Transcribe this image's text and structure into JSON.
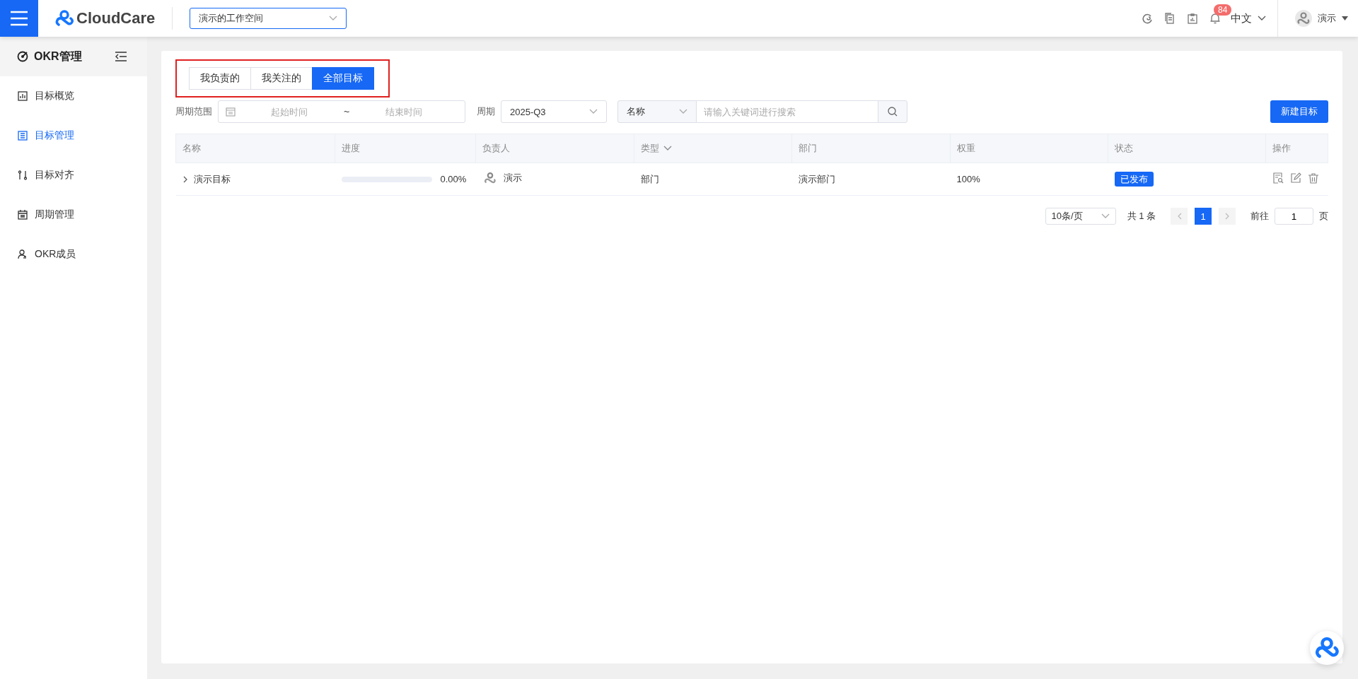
{
  "topbar": {
    "brand": "CloudCare",
    "workspace": "演示的工作空间",
    "notification_count": "84",
    "language": "中文",
    "user": "演示"
  },
  "sidebar": {
    "title": "OKR管理",
    "items": [
      {
        "label": "目标概览",
        "kind": "chart",
        "selected": false
      },
      {
        "label": "目标管理",
        "kind": "list",
        "selected": true
      },
      {
        "label": "目标对齐",
        "kind": "align",
        "selected": false
      },
      {
        "label": "周期管理",
        "kind": "calendar",
        "selected": false
      },
      {
        "label": "OKR成员",
        "kind": "member",
        "selected": false
      }
    ]
  },
  "tabs": [
    {
      "label": "我负责的",
      "selected": false
    },
    {
      "label": "我关注的",
      "selected": false
    },
    {
      "label": "全部目标",
      "selected": true
    }
  ],
  "filters": {
    "period_range_label": "周期范围",
    "start_placeholder": "起始时间",
    "separator": "~",
    "end_placeholder": "结束时间",
    "period_label": "周期",
    "period_value": "2025-Q3",
    "search_field": "名称",
    "search_placeholder": "请输入关键词进行搜索",
    "new_button": "新建目标"
  },
  "table": {
    "columns": [
      {
        "label": "名称",
        "sortable": false
      },
      {
        "label": "进度",
        "sortable": false
      },
      {
        "label": "负责人",
        "sortable": false
      },
      {
        "label": "类型",
        "sortable": true
      },
      {
        "label": "部门",
        "sortable": false
      },
      {
        "label": "权重",
        "sortable": false
      },
      {
        "label": "状态",
        "sortable": false
      },
      {
        "label": "操作",
        "sortable": false
      }
    ],
    "rows": [
      {
        "name": "演示目标",
        "expanded": false,
        "level": 0,
        "progress": "0.00%",
        "owner": "演示",
        "type": "部门",
        "department": "演示部门",
        "weight": "100%",
        "status": "已发布"
      }
    ]
  },
  "pagination": {
    "page_size": "10条/页",
    "total": "共 1 条",
    "pages": [
      {
        "label": "1",
        "selected": true
      }
    ],
    "goto_label": "前往",
    "goto_value": "1",
    "page_suffix": "页"
  }
}
